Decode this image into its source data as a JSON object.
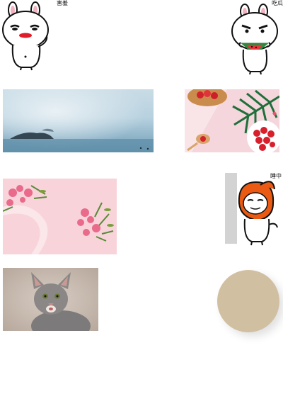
{
  "stickers": {
    "shy": {
      "caption": "害羞"
    },
    "eating": {
      "caption": "吃瓜"
    },
    "sleepy": {
      "caption": "睡中"
    }
  },
  "images": [
    {
      "name": "misty-sea-photo"
    },
    {
      "name": "strawberry-bowl-photo"
    },
    {
      "name": "pink-flowers-photo"
    },
    {
      "name": "kitten-photo"
    }
  ],
  "colors": {
    "circle_fill": "#d1bfa1",
    "sleepy_bar": "#d3d3d3"
  }
}
